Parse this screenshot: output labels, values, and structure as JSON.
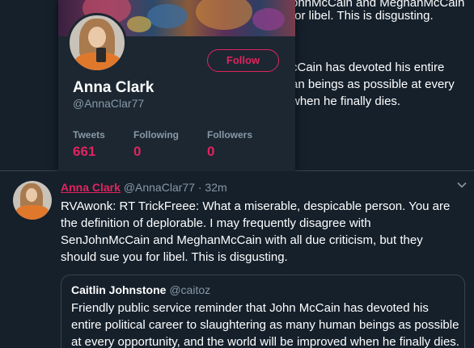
{
  "background_tweet": {
    "lines": [
      "ohnMcCain and MeghanMcCain",
      "for libel. This is disgusting.",
      "cCain has devoted his entire",
      "an beings as possible at every",
      "when he finally dies."
    ]
  },
  "profile_card": {
    "name": "Anna Clark",
    "handle": "@AnnaClar77",
    "follow_label": "Follow",
    "stats": [
      {
        "label": "Tweets",
        "value": "661"
      },
      {
        "label": "Following",
        "value": "0"
      },
      {
        "label": "Followers",
        "value": "0"
      }
    ]
  },
  "tweet": {
    "author": "Anna Clark",
    "handle": "@AnnaClar77",
    "separator": "·",
    "time": "32m",
    "text": "RVAwonk: RT TrickFreee: What a miserable, despicable person. You are the definition of deplorable.  I may frequently disagree with SenJohnMcCain and MeghanMcCain with all due criticism, but they should sue you for libel. This is disgusting."
  },
  "quoted_tweet": {
    "author": "Caitlin Johnstone",
    "handle": "@caitoz",
    "text": "Friendly public service reminder that John McCain has devoted his entire political career to slaughtering as many human beings as possible at every opportunity, and the world will be improved when he finally dies."
  },
  "colors": {
    "accent": "#e0245e",
    "background": "#15202b",
    "card": "#1c2732",
    "secondary_text": "#8899a6"
  },
  "icons": {
    "caret": "chevron-down-icon"
  }
}
